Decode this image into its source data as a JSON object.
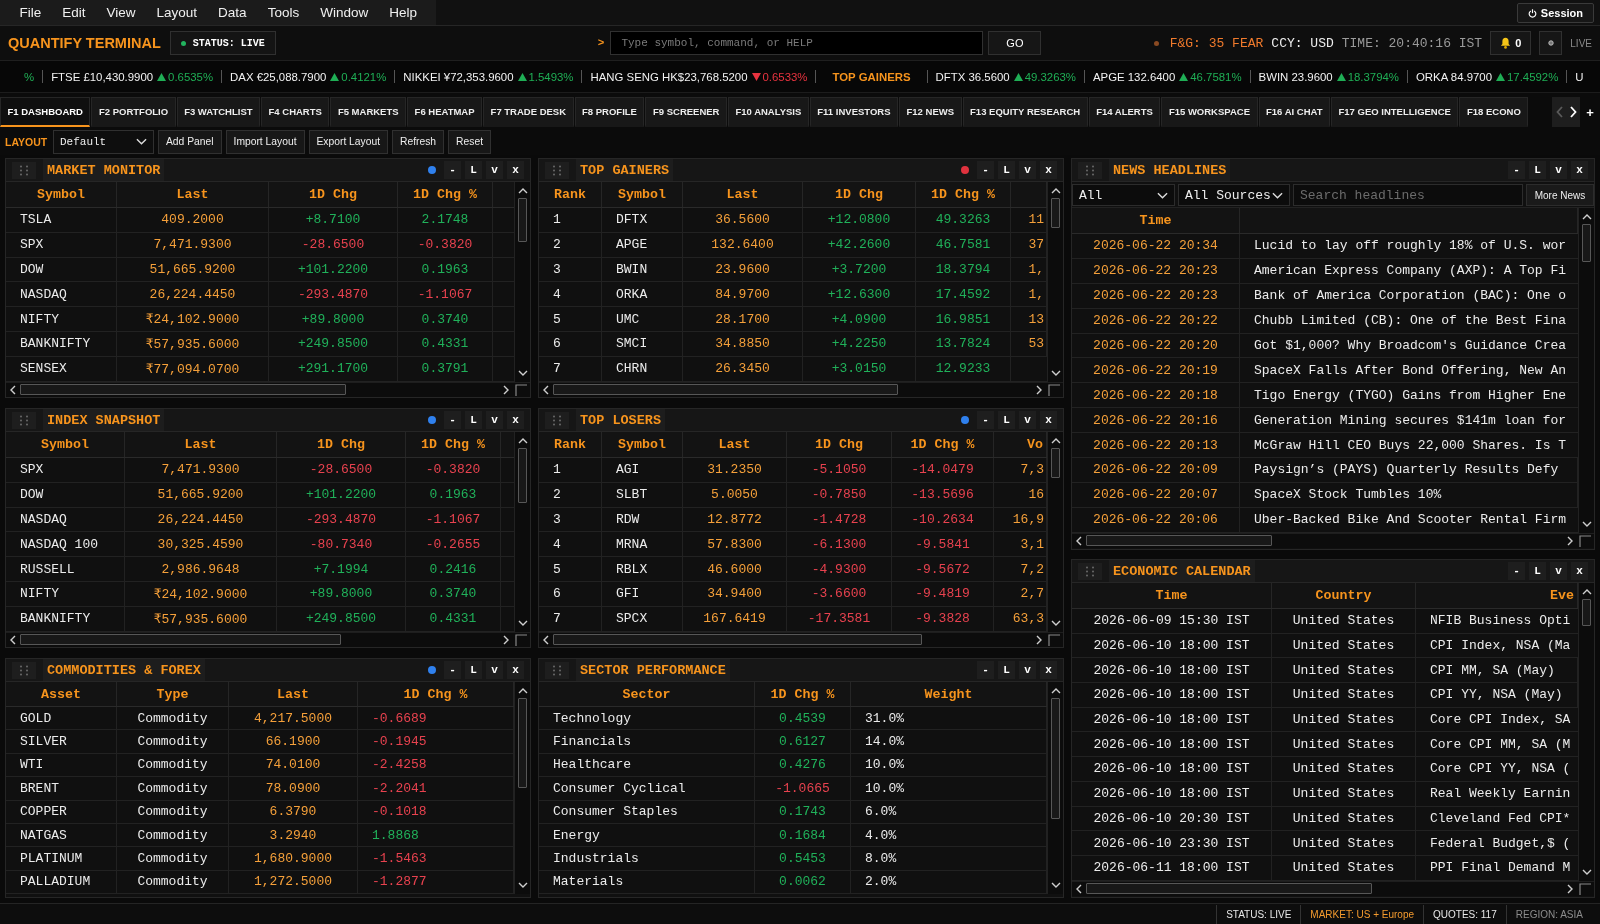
{
  "menu": [
    "File",
    "Edit",
    "View",
    "Layout",
    "Data",
    "Tools",
    "Window",
    "Help"
  ],
  "session_button": "Session",
  "header": {
    "brand": "QUANTIFY TERMINAL",
    "status": "STATUS: LIVE",
    "prompt": ">",
    "command": {
      "placeholder": "Type symbol, command, or HELP"
    },
    "go_button": "GO",
    "fear_greed": "F&G: 35 FEAR",
    "currency": "CCY: USD",
    "time": "TIME: 20:40:16 IST",
    "alerts": "0",
    "live": "LIVE"
  },
  "ticker": [
    {
      "kind": "fragment",
      "text": "%",
      "positive": true
    },
    {
      "kind": "quote",
      "symbol": "FTSE",
      "price": "£10,430.9900",
      "change": "0.6535%",
      "positive": true
    },
    {
      "kind": "quote",
      "symbol": "DAX",
      "price": "€25,088.7900",
      "change": "0.4121%",
      "positive": true
    },
    {
      "kind": "quote",
      "symbol": "NIKKEI",
      "price": "¥72,353.9600",
      "change": "1.5493%",
      "positive": true
    },
    {
      "kind": "quote",
      "symbol": "HANG SENG",
      "price": "HK$23,768.5200",
      "change": "0.6533%",
      "positive": false
    },
    {
      "kind": "section",
      "text": "TOP GAINERS"
    },
    {
      "kind": "quote",
      "symbol": "DFTX",
      "price": "36.5600",
      "change": "49.3263%",
      "positive": true
    },
    {
      "kind": "quote",
      "symbol": "APGE",
      "price": "132.6400",
      "change": "46.7581%",
      "positive": true
    },
    {
      "kind": "quote",
      "symbol": "BWIN",
      "price": "23.9600",
      "change": "18.3794%",
      "positive": true
    },
    {
      "kind": "quote",
      "symbol": "ORKA",
      "price": "84.9700",
      "change": "17.4592%",
      "positive": true
    },
    {
      "kind": "fragment",
      "text": "U"
    }
  ],
  "tabs": [
    {
      "label": "F1 DASHBOARD",
      "selected": true
    },
    {
      "label": "F2 PORTFOLIO",
      "selected": false
    },
    {
      "label": "F3 WATCHLIST",
      "selected": false
    },
    {
      "label": "F4 CHARTS",
      "selected": false
    },
    {
      "label": "F5 MARKETS",
      "selected": false
    },
    {
      "label": "F6 HEATMAP",
      "selected": false
    },
    {
      "label": "F7 TRADE DESK",
      "selected": false
    },
    {
      "label": "F8 PROFILE",
      "selected": false
    },
    {
      "label": "F9 SCREENER",
      "selected": false
    },
    {
      "label": "F10 ANALYSIS",
      "selected": false
    },
    {
      "label": "F11 INVESTORS",
      "selected": false
    },
    {
      "label": "F12 NEWS",
      "selected": false
    },
    {
      "label": "F13 EQUITY RESEARCH",
      "selected": false
    },
    {
      "label": "F14 ALERTS",
      "selected": false
    },
    {
      "label": "F15 WORKSPACE",
      "selected": false
    },
    {
      "label": "F16 AI CHAT",
      "selected": false
    },
    {
      "label": "F17 GEO INTELLIGENCE",
      "selected": false
    },
    {
      "label": "F18 ECONO",
      "selected": false
    }
  ],
  "tab_scroll": {
    "previous_enabled": false,
    "next_enabled": true
  },
  "add_tab": "+",
  "layout_bar": {
    "label": "LAYOUT",
    "layout_select": {
      "value": "Default"
    },
    "buttons": [
      "Add Panel",
      "Import Layout",
      "Export Layout",
      "Refresh",
      "Reset"
    ]
  },
  "dashboard": {
    "columns": [
      {
        "panels": [
          {
            "title": "MARKET MONITOR",
            "color": "#2f80ed",
            "controls": [
              "-",
              "L",
              "v",
              "x"
            ],
            "columns": [
              {
                "label": "Symbol",
                "kind": "name"
              },
              {
                "label": "Last",
                "kind": "price"
              },
              {
                "label": "1D Chg",
                "kind": "change"
              },
              {
                "label": "1D Chg %",
                "kind": "change"
              }
            ],
            "rows": [
              {
                "cells": [
                  "TSLA",
                  "409.2000",
                  "+8.7100",
                  "2.1748"
                ],
                "positive": true
              },
              {
                "cells": [
                  "SPX",
                  "7,471.9300",
                  "-28.6500",
                  "-0.3820"
                ],
                "positive": false
              },
              {
                "cells": [
                  "DOW",
                  "51,665.9200",
                  "+101.2200",
                  "0.1963"
                ],
                "positive": true
              },
              {
                "cells": [
                  "NASDAQ",
                  "26,224.4450",
                  "-293.4870",
                  "-1.1067"
                ],
                "positive": false
              },
              {
                "cells": [
                  "NIFTY",
                  "₹24,102.9000",
                  "+89.8000",
                  "0.3740"
                ],
                "positive": true
              },
              {
                "cells": [
                  "BANKNIFTY",
                  "₹57,935.6000",
                  "+249.8500",
                  "0.4331"
                ],
                "positive": true
              },
              {
                "cells": [
                  "SENSEX",
                  "₹77,094.0700",
                  "+291.1700",
                  "0.3791"
                ],
                "positive": true
              }
            ]
          },
          {
            "title": "INDEX SNAPSHOT",
            "color": "#2f80ed",
            "controls": [
              "-",
              "L",
              "v",
              "x"
            ],
            "columns": [
              {
                "label": "Symbol",
                "kind": "name"
              },
              {
                "label": "Last",
                "kind": "price"
              },
              {
                "label": "1D Chg",
                "kind": "change"
              },
              {
                "label": "1D Chg %",
                "kind": "change"
              }
            ],
            "rows": [
              {
                "cells": [
                  "SPX",
                  "7,471.9300",
                  "-28.6500",
                  "-0.3820"
                ],
                "positive": false
              },
              {
                "cells": [
                  "DOW",
                  "51,665.9200",
                  "+101.2200",
                  "0.1963"
                ],
                "positive": true
              },
              {
                "cells": [
                  "NASDAQ",
                  "26,224.4450",
                  "-293.4870",
                  "-1.1067"
                ],
                "positive": false
              },
              {
                "cells": [
                  "NASDAQ 100",
                  "30,325.4590",
                  "-80.7340",
                  "-0.2655"
                ],
                "positive": false
              },
              {
                "cells": [
                  "RUSSELL",
                  "2,986.9648",
                  "+7.1994",
                  "0.2416"
                ],
                "positive": true
              },
              {
                "cells": [
                  "NIFTY",
                  "₹24,102.9000",
                  "+89.8000",
                  "0.3740"
                ],
                "positive": true
              },
              {
                "cells": [
                  "BANKNIFTY",
                  "₹57,935.6000",
                  "+249.8500",
                  "0.4331"
                ],
                "positive": true
              }
            ]
          },
          {
            "title": "COMMODITIES & FOREX",
            "color": "#2f80ed",
            "controls": [
              "-",
              "L",
              "v",
              "x"
            ],
            "columns": [
              {
                "label": "Asset",
                "kind": "name"
              },
              {
                "label": "Type",
                "kind": "label"
              },
              {
                "label": "Last",
                "kind": "price"
              },
              {
                "label": "1D Chg %",
                "kind": "change"
              }
            ],
            "rows": [
              {
                "cells": [
                  "GOLD",
                  "Commodity",
                  "4,217.5000",
                  "-0.6689"
                ],
                "positive": false
              },
              {
                "cells": [
                  "SILVER",
                  "Commodity",
                  "66.1900",
                  "-0.1945"
                ],
                "positive": false
              },
              {
                "cells": [
                  "WTI",
                  "Commodity",
                  "74.0100",
                  "-2.4258"
                ],
                "positive": false
              },
              {
                "cells": [
                  "BRENT",
                  "Commodity",
                  "78.0900",
                  "-2.2041"
                ],
                "positive": false
              },
              {
                "cells": [
                  "COPPER",
                  "Commodity",
                  "6.3790",
                  "-0.1018"
                ],
                "positive": false
              },
              {
                "cells": [
                  "NATGAS",
                  "Commodity",
                  "3.2940",
                  "1.8868"
                ],
                "positive": true
              },
              {
                "cells": [
                  "PLATINUM",
                  "Commodity",
                  "1,680.9000",
                  "-1.5463"
                ],
                "positive": false
              },
              {
                "cells": [
                  "PALLADIUM",
                  "Commodity",
                  "1,272.5000",
                  "-1.2877"
                ],
                "positive": false
              }
            ]
          }
        ]
      },
      {
        "panels": [
          {
            "title": "TOP GAINERS",
            "color": "#e0323e",
            "controls": [
              "-",
              "L",
              "v",
              "x"
            ],
            "columns": [
              {
                "label": "Rank",
                "kind": "rank"
              },
              {
                "label": "Symbol",
                "kind": "name"
              },
              {
                "label": "Last",
                "kind": "price"
              },
              {
                "label": "1D Chg",
                "kind": "change"
              },
              {
                "label": "1D Chg %",
                "kind": "change"
              },
              {
                "kind": "volume"
              }
            ],
            "rows": [
              {
                "cells": [
                  "1",
                  "DFTX",
                  "36.5600",
                  "+12.0800",
                  "49.3263",
                  "11"
                ],
                "positive": true
              },
              {
                "cells": [
                  "2",
                  "APGE",
                  "132.6400",
                  "+42.2600",
                  "46.7581",
                  "37"
                ],
                "positive": true
              },
              {
                "cells": [
                  "3",
                  "BWIN",
                  "23.9600",
                  "+3.7200",
                  "18.3794",
                  "1,"
                ],
                "positive": true
              },
              {
                "cells": [
                  "4",
                  "ORKA",
                  "84.9700",
                  "+12.6300",
                  "17.4592",
                  "1,"
                ],
                "positive": true
              },
              {
                "cells": [
                  "5",
                  "UMC",
                  "28.1700",
                  "+4.0900",
                  "16.9851",
                  "13"
                ],
                "positive": true
              },
              {
                "cells": [
                  "6",
                  "SMCI",
                  "34.8850",
                  "+4.2250",
                  "13.7824",
                  "53"
                ],
                "positive": true
              },
              {
                "cells": [
                  "7",
                  "CHRN",
                  "26.3450",
                  "+3.0150",
                  "12.9233"
                ],
                "positive": true
              }
            ]
          },
          {
            "title": "TOP LOSERS",
            "color": "#2f80ed",
            "controls": [
              "-",
              "L",
              "v",
              "x"
            ],
            "columns": [
              {
                "label": "Rank",
                "kind": "rank"
              },
              {
                "label": "Symbol",
                "kind": "name"
              },
              {
                "label": "Last",
                "kind": "price"
              },
              {
                "label": "1D Chg",
                "kind": "change"
              },
              {
                "label": "1D Chg %",
                "kind": "change"
              },
              {
                "label": "Vo",
                "kind": "volume"
              }
            ],
            "rows": [
              {
                "cells": [
                  "1",
                  "AGI",
                  "31.2350",
                  "-5.1050",
                  "-14.0479",
                  "7,3"
                ],
                "positive": false
              },
              {
                "cells": [
                  "2",
                  "SLBT",
                  "5.0050",
                  "-0.7850",
                  "-13.5696",
                  "16"
                ],
                "positive": false
              },
              {
                "cells": [
                  "3",
                  "RDW",
                  "12.8772",
                  "-1.4728",
                  "-10.2634",
                  "16,9"
                ],
                "positive": false
              },
              {
                "cells": [
                  "4",
                  "MRNA",
                  "57.8300",
                  "-6.1300",
                  "-9.5841",
                  "3,1"
                ],
                "positive": false
              },
              {
                "cells": [
                  "5",
                  "RBLX",
                  "46.6000",
                  "-4.9300",
                  "-9.5672",
                  "7,2"
                ],
                "positive": false
              },
              {
                "cells": [
                  "6",
                  "GFI",
                  "34.9400",
                  "-3.6600",
                  "-9.4819",
                  "2,7"
                ],
                "positive": false
              },
              {
                "cells": [
                  "7",
                  "SPCX",
                  "167.6419",
                  "-17.3581",
                  "-9.3828",
                  "63,3"
                ],
                "positive": false
              }
            ]
          },
          {
            "title": "SECTOR PERFORMANCE",
            "controls": [
              "-",
              "L",
              "v",
              "x"
            ],
            "columns": [
              {
                "label": "Sector",
                "kind": "name"
              },
              {
                "label": "1D Chg %",
                "kind": "change"
              },
              {
                "label": "Weight",
                "kind": "text"
              }
            ],
            "rows": [
              {
                "cells": [
                  "Technology",
                  "0.4539",
                  "31.0%"
                ],
                "positive": true
              },
              {
                "cells": [
                  "Financials",
                  "0.6127",
                  "14.0%"
                ],
                "positive": true
              },
              {
                "cells": [
                  "Healthcare",
                  "0.4276",
                  "10.0%"
                ],
                "positive": true
              },
              {
                "cells": [
                  "Consumer Cyclical",
                  "-1.0665",
                  "10.0%"
                ],
                "positive": false
              },
              {
                "cells": [
                  "Consumer Staples",
                  "0.1743",
                  "6.0%"
                ],
                "positive": true
              },
              {
                "cells": [
                  "Energy",
                  "0.1684",
                  "4.0%"
                ],
                "positive": true
              },
              {
                "cells": [
                  "Industrials",
                  "0.5453",
                  "8.0%"
                ],
                "positive": true
              },
              {
                "cells": [
                  "Materials",
                  "0.0062",
                  "2.0%"
                ],
                "positive": true
              }
            ]
          }
        ]
      },
      {
        "panels": [
          {
            "title": "NEWS HEADLINES",
            "controls": [
              "-",
              "L",
              "v",
              "x"
            ],
            "filters": [
              {
                "value": "All"
              },
              {
                "value": "All Sources"
              }
            ],
            "search": {
              "placeholder": "Search headlines"
            },
            "more_button": "More News",
            "columns": [
              {
                "label": "Time",
                "kind": "timestamp"
              },
              {
                "kind": "text"
              }
            ],
            "rows": [
              {
                "cells": [
                  "2026-06-22 20:34",
                  "Lucid to lay off roughly 18% of U.S. wor"
                ]
              },
              {
                "cells": [
                  "2026-06-22 20:23",
                  "American Express Company (AXP): A Top Fi"
                ]
              },
              {
                "cells": [
                  "2026-06-22 20:23",
                  "Bank of America Corporation (BAC): One o"
                ]
              },
              {
                "cells": [
                  "2026-06-22 20:22",
                  "Chubb Limited (CB): One of the Best Fina"
                ]
              },
              {
                "cells": [
                  "2026-06-22 20:20",
                  "Got $1,000? Why Broadcom's Guidance Crea"
                ]
              },
              {
                "cells": [
                  "2026-06-22 20:19",
                  "SpaceX Falls After Bond Offering, New An"
                ]
              },
              {
                "cells": [
                  "2026-06-22 20:18",
                  "Tigo Energy (TYGO) Gains from Higher Ene"
                ]
              },
              {
                "cells": [
                  "2026-06-22 20:16",
                  "Generation Mining secures $141m loan for"
                ]
              },
              {
                "cells": [
                  "2026-06-22 20:13",
                  "McGraw Hill CEO Buys 22,000 Shares. Is T"
                ]
              },
              {
                "cells": [
                  "2026-06-22 20:09",
                  "Paysign’s (PAYS) Quarterly Results Defy"
                ]
              },
              {
                "cells": [
                  "2026-06-22 20:07",
                  "SpaceX Stock Tumbles 10%"
                ]
              },
              {
                "cells": [
                  "2026-06-22 20:06",
                  "Uber-Backed Bike And Scooter Rental Firm"
                ]
              }
            ]
          },
          {
            "title": "ECONOMIC CALENDAR",
            "controls": [
              "-",
              "L",
              "v",
              "x"
            ],
            "columns": [
              {
                "label": "Time",
                "kind": "label"
              },
              {
                "label": "Country",
                "kind": "label"
              },
              {
                "label": "Eve",
                "kind": "text"
              }
            ],
            "rows": [
              {
                "cells": [
                  "2026-06-09 15:30 IST",
                  "United States",
                  "NFIB Business Opti"
                ]
              },
              {
                "cells": [
                  "2026-06-10 18:00 IST",
                  "United States",
                  "CPI Index, NSA (Ma"
                ]
              },
              {
                "cells": [
                  "2026-06-10 18:00 IST",
                  "United States",
                  "CPI MM, SA (May)"
                ]
              },
              {
                "cells": [
                  "2026-06-10 18:00 IST",
                  "United States",
                  "CPI YY, NSA (May)"
                ]
              },
              {
                "cells": [
                  "2026-06-10 18:00 IST",
                  "United States",
                  "Core CPI Index, SA"
                ]
              },
              {
                "cells": [
                  "2026-06-10 18:00 IST",
                  "United States",
                  "Core CPI MM, SA (M"
                ]
              },
              {
                "cells": [
                  "2026-06-10 18:00 IST",
                  "United States",
                  "Core CPI YY, NSA ("
                ]
              },
              {
                "cells": [
                  "2026-06-10 18:00 IST",
                  "United States",
                  "Real Weekly Earnin"
                ]
              },
              {
                "cells": [
                  "2026-06-10 20:30 IST",
                  "United States",
                  "Cleveland Fed CPI*"
                ]
              },
              {
                "cells": [
                  "2026-06-10 23:30 IST",
                  "United States",
                  "Federal Budget,$ ("
                ]
              },
              {
                "cells": [
                  "2026-06-11 18:00 IST",
                  "United States",
                  "PPI Final Demand M"
                ]
              }
            ]
          }
        ]
      }
    ]
  },
  "status_bar": [
    {
      "text": "STATUS: LIVE",
      "color": "#e8e8e8"
    },
    {
      "text": "MARKET: US + Europe",
      "color": "#f39a2e"
    },
    {
      "text": "QUOTES: 117",
      "color": "#e8e8e8"
    },
    {
      "text": "REGION: ASIA",
      "color": "#8c8c8c"
    }
  ]
}
